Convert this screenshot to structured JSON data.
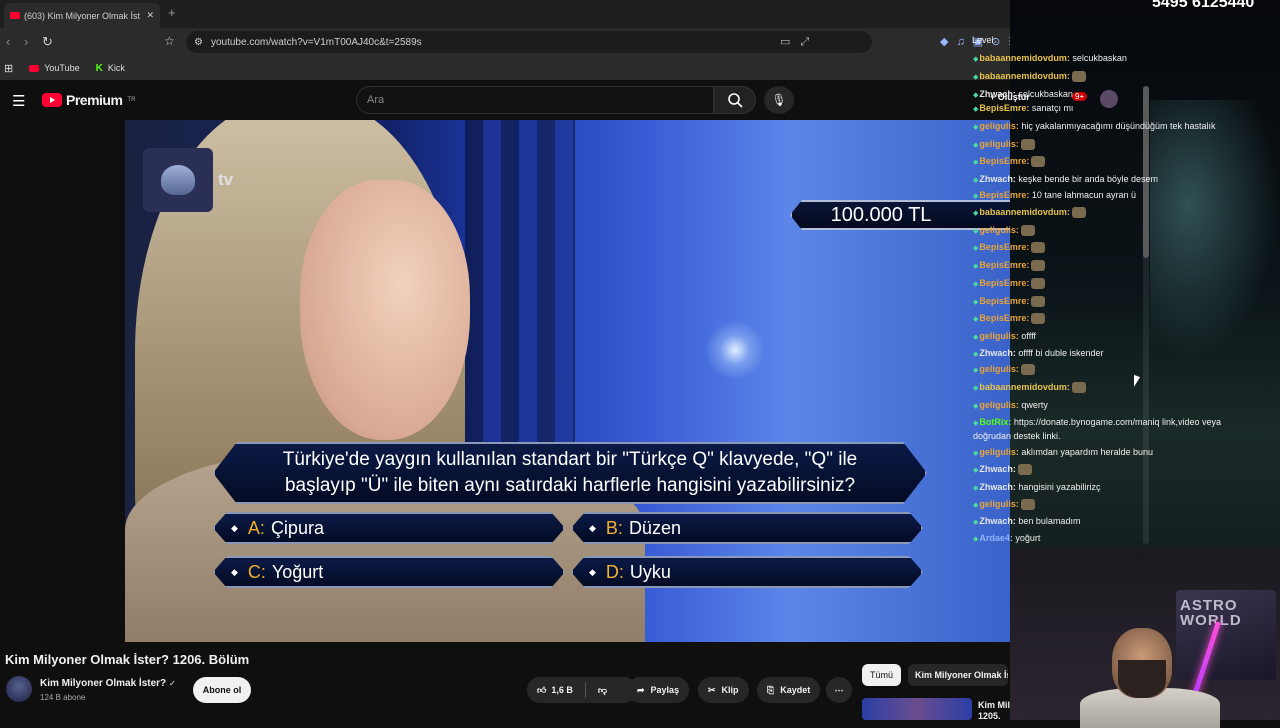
{
  "browser": {
    "tab_title": "(603) Kim Milyoner Olmak İst",
    "url": "youtube.com/watch?v=V1mT00AJ40c&t=2589s",
    "bookmarks": [
      "YouTube",
      "Kick"
    ]
  },
  "youtube": {
    "logo_text": "Premium",
    "logo_sup": "TR",
    "search_placeholder": "Ara",
    "create_label": "+ Oluştur",
    "notification_count": "9+"
  },
  "video": {
    "channel_watermark": "tv",
    "prize": "100.000 TL",
    "question": "Türkiye'de yaygın kullanılan standart bir \"Türkçe Q\" klavyede, \"Q\" ile başlayıp \"Ü\" ile biten aynı satırdaki harflerle hangisini yazabilirsiniz?",
    "answers": [
      {
        "letter": "A:",
        "text": "Çipura"
      },
      {
        "letter": "B:",
        "text": "Düzen"
      },
      {
        "letter": "C:",
        "text": "Yoğurt"
      },
      {
        "letter": "D:",
        "text": "Uyku"
      }
    ]
  },
  "meta": {
    "title": "Kim Milyoner Olmak İster? 1206. Bölüm",
    "channel_name": "Kim Milyoner Olmak İster?",
    "verified": "✓",
    "subscribers": "124 B abone",
    "subscribe_label": "Abone ol",
    "likes": "1,6 B",
    "share_label": "Paylaş",
    "clip_label": "Klip",
    "save_label": "Kaydet",
    "chip_all": "Tümü",
    "chip_channel": "Kim Milyoner Olmak İster",
    "rec_title": "Kim Mil\n1205."
  },
  "stream": {
    "phone_fragment": "5495 6125440",
    "poster_text": "ASTRO\nWORLD"
  },
  "chat": {
    "header": "Level:",
    "lines": [
      {
        "user": "babaannemidovdum:",
        "msg": "selcukbaskan",
        "color": "#e8c34a"
      },
      {
        "user": "babaannemidovdum:",
        "msg": "",
        "color": "#e8c34a",
        "emote": true
      },
      {
        "user": "Zhwach:",
        "msg": "selcukbaskan",
        "color": "#e6e6e6"
      },
      {
        "user": "BepisEmre:",
        "msg": "sanatçı mı",
        "color": "#e8c34a"
      },
      {
        "user": "geligulis:",
        "msg": "hiç yakalanmıyacağımı düşündüğüm tek hastalık",
        "color": "#e8a33a"
      },
      {
        "user": "geligulis:",
        "msg": "",
        "color": "#e8a33a",
        "emote": true
      },
      {
        "user": "BepisEmre:",
        "msg": "",
        "color": "#e8a33a",
        "emote": true
      },
      {
        "user": "Zhwach:",
        "msg": "keşke bende bir anda böyle desem",
        "color": "#e6e6e6"
      },
      {
        "user": "BepisEmre:",
        "msg": "10 tane lahmacun ayran ü",
        "color": "#e8a33a"
      },
      {
        "user": "babaannemidovdum:",
        "msg": "",
        "color": "#e8c34a",
        "emote": true
      },
      {
        "user": "geligulis:",
        "msg": "",
        "color": "#e8a33a",
        "emote": true
      },
      {
        "user": "BepisEmre:",
        "msg": "",
        "color": "#e8a33a",
        "emote": true
      },
      {
        "user": "BepisEmre:",
        "msg": "",
        "color": "#e8a33a",
        "emote": true
      },
      {
        "user": "BepisEmre:",
        "msg": "",
        "color": "#e8a33a",
        "emote": true
      },
      {
        "user": "BepisEmre:",
        "msg": "",
        "color": "#e8a33a",
        "emote": true
      },
      {
        "user": "BepisEmre:",
        "msg": "",
        "color": "#e8a33a",
        "emote": true
      },
      {
        "user": "geligulis:",
        "msg": "offff",
        "color": "#e8a33a"
      },
      {
        "user": "Zhwach:",
        "msg": "offff bi duble iskender",
        "color": "#e6e6e6"
      },
      {
        "user": "geligulis:",
        "msg": "",
        "color": "#e8a33a",
        "emote": true
      },
      {
        "user": "babaannemidovdum:",
        "msg": "",
        "color": "#e8c34a",
        "emote": true
      },
      {
        "user": "geligulis:",
        "msg": "qwerty",
        "color": "#e8a33a"
      },
      {
        "user": "BotRix:",
        "msg": "https://donate.bynogame.com/maniq link,video veya doğrudan destek linki.",
        "color": "#53fc18"
      },
      {
        "user": "geligulis:",
        "msg": "aklımdan yapardım heralde bunu",
        "color": "#e8a33a"
      },
      {
        "user": "Zhwach:",
        "msg": "",
        "color": "#e6e6e6",
        "emote": true
      },
      {
        "user": "Zhwach:",
        "msg": "hangisini yazabilirizç",
        "color": "#e6e6e6"
      },
      {
        "user": "geligulis:",
        "msg": "",
        "color": "#e8a33a",
        "emote": true
      },
      {
        "user": "Zhwach:",
        "msg": "ben bulamadım",
        "color": "#e6e6e6"
      },
      {
        "user": "Ardae4:",
        "msg": "yoğurt",
        "color": "#8fb4ff"
      }
    ]
  },
  "colors": {
    "accent_red": "#ff0033",
    "kick_green": "#53fc18",
    "answer_letter": "#f0b030"
  }
}
